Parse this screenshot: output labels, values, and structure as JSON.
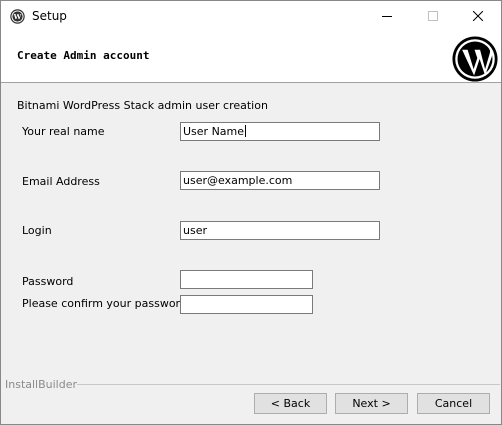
{
  "window": {
    "title": "Setup"
  },
  "header": {
    "title": "Create Admin account",
    "logo_icon": "wordpress-logo-icon"
  },
  "form": {
    "subtitle": "Bitnami WordPress Stack admin user creation",
    "real_name": {
      "label": "Your real name",
      "value": "User Name"
    },
    "email": {
      "label": "Email Address",
      "value": "user@example.com"
    },
    "login": {
      "label": "Login",
      "value": "user"
    },
    "password": {
      "label": "Password",
      "value": ""
    },
    "confirm_password": {
      "label": "Please confirm your password",
      "value": ""
    }
  },
  "footer": {
    "brand": "InstallBuilder",
    "back_label": "< Back",
    "next_label": "Next >",
    "cancel_label": "Cancel"
  },
  "colors": {
    "window_bg": "#f0f0f0",
    "header_bg": "#ffffff",
    "wordpress_logo": "#000000"
  }
}
